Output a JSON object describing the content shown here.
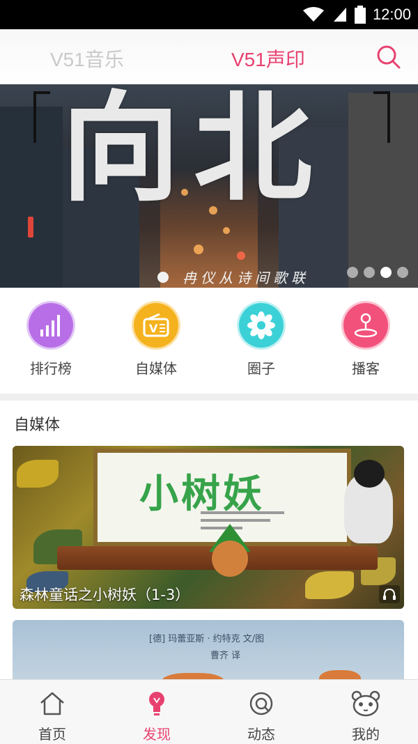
{
  "status_bar": {
    "time": "12:00",
    "icons": [
      "wifi-icon",
      "signal-icon",
      "battery-icon"
    ]
  },
  "header": {
    "tabs": [
      {
        "label": "V51音乐",
        "active": false
      },
      {
        "label": "V51声印",
        "active": true
      }
    ],
    "search_icon": "search-icon",
    "accent_color": "#e8416f"
  },
  "banner": {
    "title": "向北",
    "subtitle": "冉仪从诗间歌联",
    "pager": {
      "count": 4,
      "active_index": 2
    }
  },
  "categories": [
    {
      "label": "排行榜",
      "icon": "chart-bars-icon",
      "color": "#b86ee6"
    },
    {
      "label": "自媒体",
      "icon": "radio-icon",
      "color": "#f5b21f"
    },
    {
      "label": "圈子",
      "icon": "flower-icon",
      "color": "#3bd1d6"
    },
    {
      "label": "播客",
      "icon": "podcast-person-icon",
      "color": "#f2517b"
    }
  ],
  "section": {
    "title": "自媒体",
    "cards": [
      {
        "book_title": "小树妖",
        "caption": "森林童话之小树妖（1-3）",
        "icon": "headphone-icon"
      },
      {
        "line1": "[德] 玛蕾亚斯 · 约特克  文/图",
        "line2": "曹齐  译"
      }
    ]
  },
  "bottom_nav": [
    {
      "label": "首页",
      "icon": "home-icon",
      "active": false
    },
    {
      "label": "发现",
      "icon": "lightbulb-icon",
      "active": true
    },
    {
      "label": "动态",
      "icon": "chat-bubble-icon",
      "active": false
    },
    {
      "label": "我的",
      "icon": "panda-face-icon",
      "active": false
    }
  ]
}
